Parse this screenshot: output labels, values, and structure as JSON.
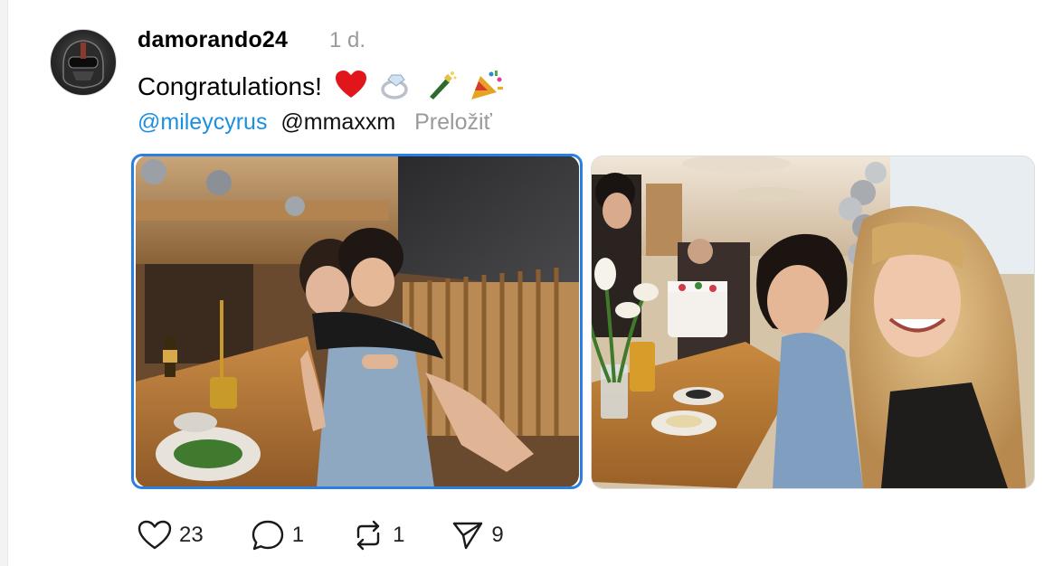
{
  "post": {
    "username": "damorando24",
    "time": "1 d.",
    "text": "Congratulations!",
    "emojis": [
      "heart-emoji",
      "ring-emoji",
      "champagne-emoji",
      "party-popper-emoji"
    ],
    "mentions": [
      "@mileycyrus",
      "@mmaxxm"
    ],
    "translate_label": "Preložiť",
    "photos": [
      {
        "name": "photo-couple-at-dinner-table"
      },
      {
        "name": "photo-couple-smiling-at-cake"
      }
    ]
  },
  "actions": {
    "likes": "23",
    "replies": "1",
    "reposts": "1",
    "shares": "9"
  },
  "colors": {
    "mention": "#1d8fe0",
    "muted": "#9a9a9a",
    "focus": "#2b7fe0"
  }
}
